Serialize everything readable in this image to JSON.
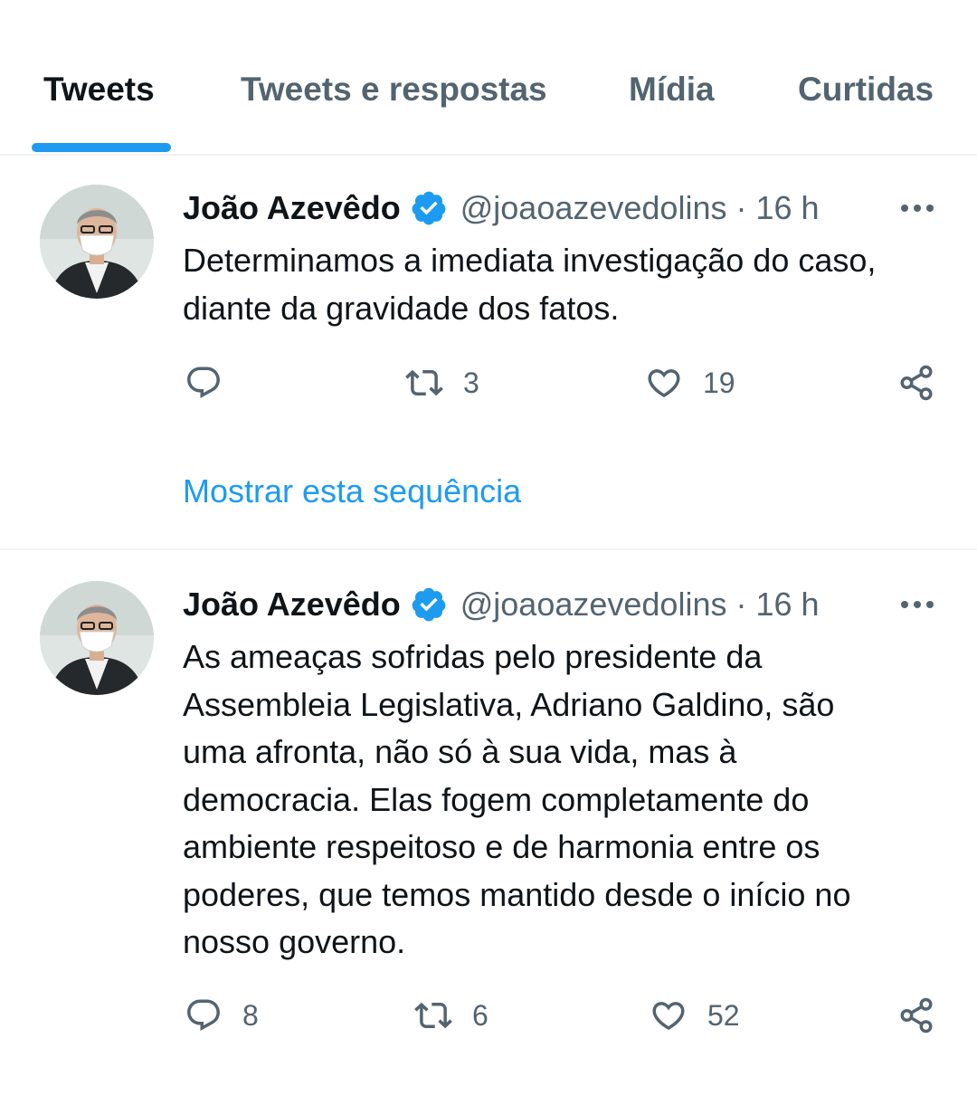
{
  "tabs": [
    {
      "label": "Tweets",
      "active": true
    },
    {
      "label": "Tweets e respostas",
      "active": false
    },
    {
      "label": "Mídia",
      "active": false
    },
    {
      "label": "Curtidas",
      "active": false
    }
  ],
  "colors": {
    "accent": "#1d9bf0",
    "secondary_text": "#536471",
    "primary_text": "#0f1419"
  },
  "tweets": [
    {
      "author_name": "João Azevêdo",
      "handle": "@joaoazevedolins",
      "separator": "·",
      "time": "16 h",
      "text": "Determinamos a imediata investigação do caso,\ndiante da gravidade dos fatos.",
      "replies": "",
      "retweets": "3",
      "likes": "19",
      "show_thread": "Mostrar esta sequência"
    },
    {
      "author_name": "João Azevêdo",
      "handle": "@joaoazevedolins",
      "separator": "·",
      "time": "16 h",
      "text": "As ameaças sofridas pelo presidente da\nAssembleia Legislativa, Adriano Galdino, são\numa afronta, não só à sua vida, mas à\ndemocracia. Elas fogem completamente do\nambiente respeitoso e de harmonia entre os\npoderes, que temos mantido desde o início no\nnosso governo.",
      "replies": "8",
      "retweets": "6",
      "likes": "52"
    }
  ],
  "icons": [
    "verified-badge-icon",
    "more-options-icon",
    "reply-icon",
    "retweet-icon",
    "like-icon",
    "share-icon"
  ]
}
